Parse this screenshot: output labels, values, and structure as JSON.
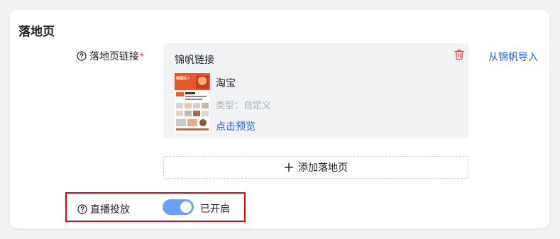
{
  "section": {
    "title": "落地页"
  },
  "landing_page_field": {
    "label": "落地页链接",
    "required_mark": "*",
    "box_title": "锦帆链接",
    "import_link": "从锦帆导入",
    "item": {
      "name": "淘宝",
      "type_label": "类型：",
      "type_value": "自定义",
      "preview_link": "点击预览",
      "thumbnail_text": "我是达人"
    },
    "add_button_label": "添加落地页"
  },
  "live_field": {
    "label": "直播投放",
    "switch_on": true,
    "switch_text": "已开启"
  },
  "colors": {
    "accent": "#165dff",
    "switch_on": "#6aa1ff",
    "highlight_border": "#e8000b",
    "delete_icon": "#f53f3f"
  },
  "icons": {
    "help": "question-circle-icon",
    "delete": "trash-icon",
    "add": "plus-icon"
  }
}
